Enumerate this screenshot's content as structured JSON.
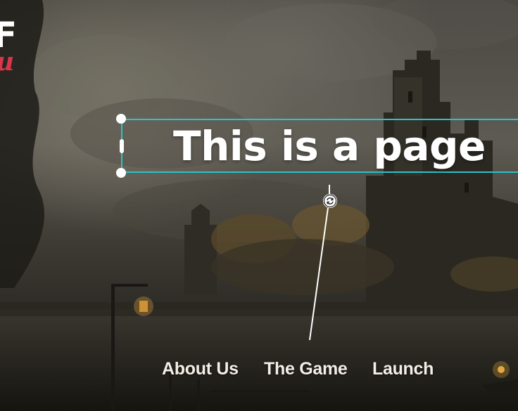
{
  "page": {
    "headline": "This is a page"
  },
  "logo": {
    "letter_top": "F",
    "letter_bottom": "u",
    "accent_color": "#d9364b"
  },
  "selection": {
    "frame_color": "#28c4cc",
    "rotate_icon": "rotate-icon"
  },
  "nav": {
    "items": [
      {
        "label": "About Us"
      },
      {
        "label": "The Game"
      },
      {
        "label": "Launch"
      }
    ]
  }
}
